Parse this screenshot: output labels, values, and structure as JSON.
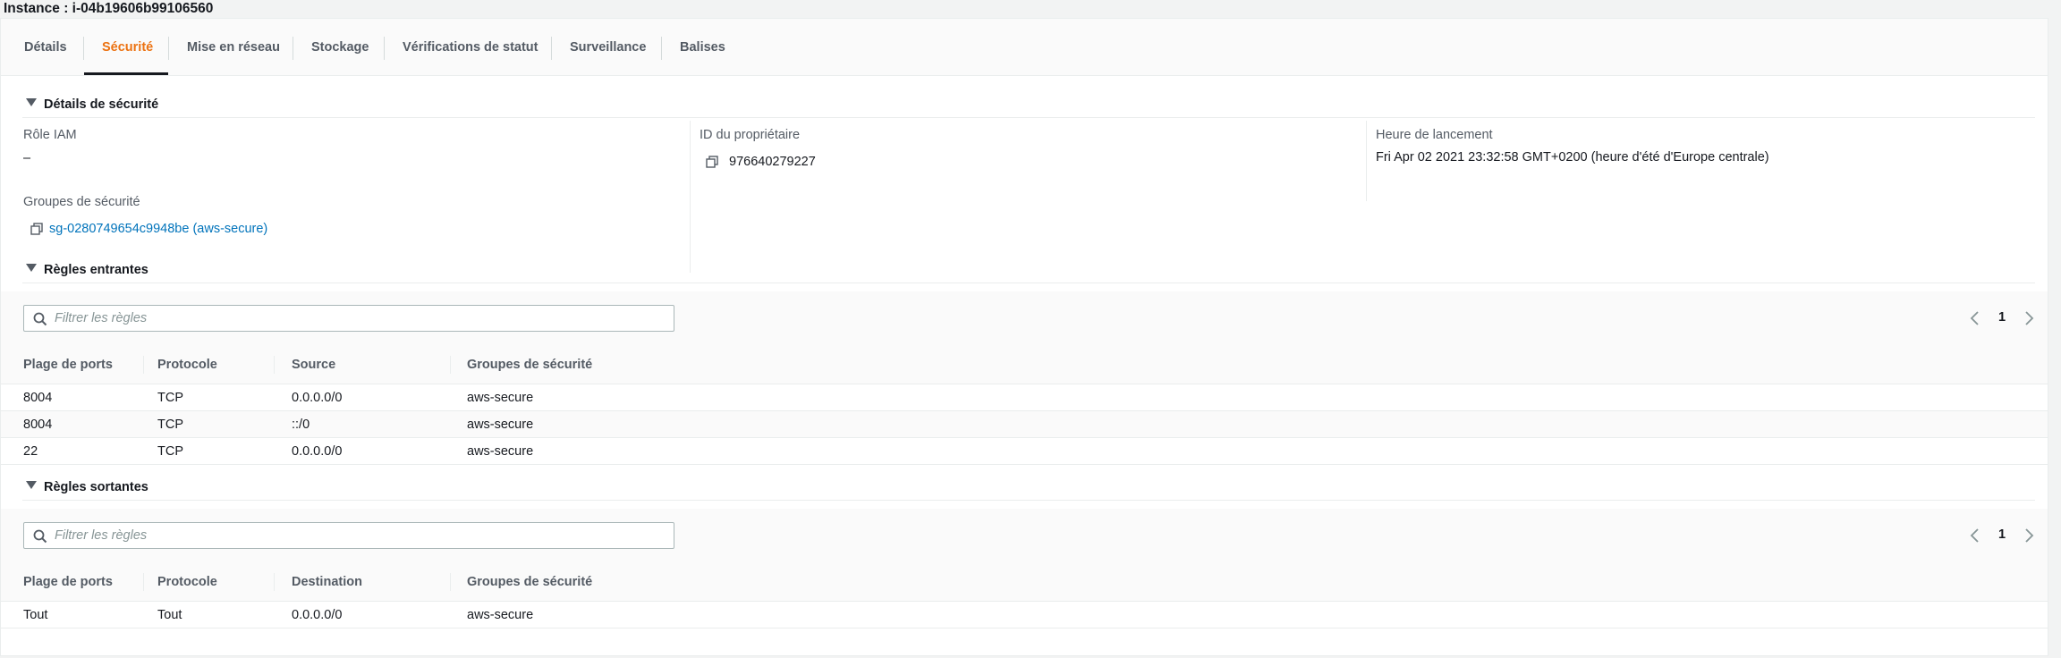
{
  "instance": {
    "title": "Instance : i-04b19606b99106560"
  },
  "tabs": [
    {
      "label": "Détails"
    },
    {
      "label": "Sécurité"
    },
    {
      "label": "Mise en réseau"
    },
    {
      "label": "Stockage"
    },
    {
      "label": "Vérifications de statut"
    },
    {
      "label": "Surveillance"
    },
    {
      "label": "Balises"
    }
  ],
  "active_tab": "Sécurité",
  "colors": {
    "accent": "#ec7211",
    "link": "#0073bb",
    "text": "#16191f",
    "muted": "#545b64"
  },
  "security_details": {
    "header": "Détails de sécurité",
    "iam_role": {
      "label": "Rôle IAM",
      "value": "–"
    },
    "owner_id": {
      "label": "ID du propriétaire",
      "value": "976640279227"
    },
    "launch_time": {
      "label": "Heure de lancement",
      "value": "Fri Apr 02 2021 23:32:58 GMT+0200 (heure d'été d'Europe centrale)"
    },
    "security_groups": {
      "label": "Groupes de sécurité",
      "value": "sg-0280749654c9948be (aws-secure)"
    }
  },
  "inbound": {
    "header": "Règles entrantes",
    "filter_placeholder": "Filtrer les règles",
    "page": "1",
    "columns": [
      "Plage de ports",
      "Protocole",
      "Source",
      "Groupes de sécurité"
    ],
    "rows": [
      [
        "8004",
        "TCP",
        "0.0.0.0/0",
        "aws-secure"
      ],
      [
        "8004",
        "TCP",
        "::/0",
        "aws-secure"
      ],
      [
        "22",
        "TCP",
        "0.0.0.0/0",
        "aws-secure"
      ]
    ]
  },
  "outbound": {
    "header": "Règles sortantes",
    "filter_placeholder": "Filtrer les règles",
    "page": "1",
    "columns": [
      "Plage de ports",
      "Protocole",
      "Destination",
      "Groupes de sécurité"
    ],
    "rows": [
      [
        "Tout",
        "Tout",
        "0.0.0.0/0",
        "aws-secure"
      ]
    ]
  },
  "icons": {
    "copy": "copy-icon",
    "search": "search-icon",
    "prev": "chevron-left-icon",
    "next": "chevron-right-icon",
    "caret": "caret-down-icon"
  }
}
